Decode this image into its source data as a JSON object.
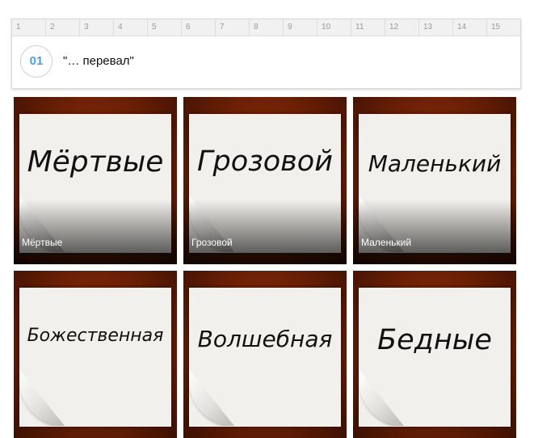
{
  "ruler": [
    "1",
    "2",
    "3",
    "4",
    "5",
    "6",
    "7",
    "8",
    "9",
    "10",
    "11",
    "12",
    "13",
    "14",
    "15"
  ],
  "question": {
    "number": "01",
    "text": "\"… перевал\""
  },
  "options": [
    {
      "word": "Мёртвые",
      "caption": "Мёртвые"
    },
    {
      "word": "Грозовой",
      "caption": "Грозовой"
    },
    {
      "word": "Маленький",
      "caption": "Маленький"
    },
    {
      "word": "Божественная",
      "caption": ""
    },
    {
      "word": "Волшебная",
      "caption": ""
    },
    {
      "word": "Бедные",
      "caption": ""
    }
  ]
}
